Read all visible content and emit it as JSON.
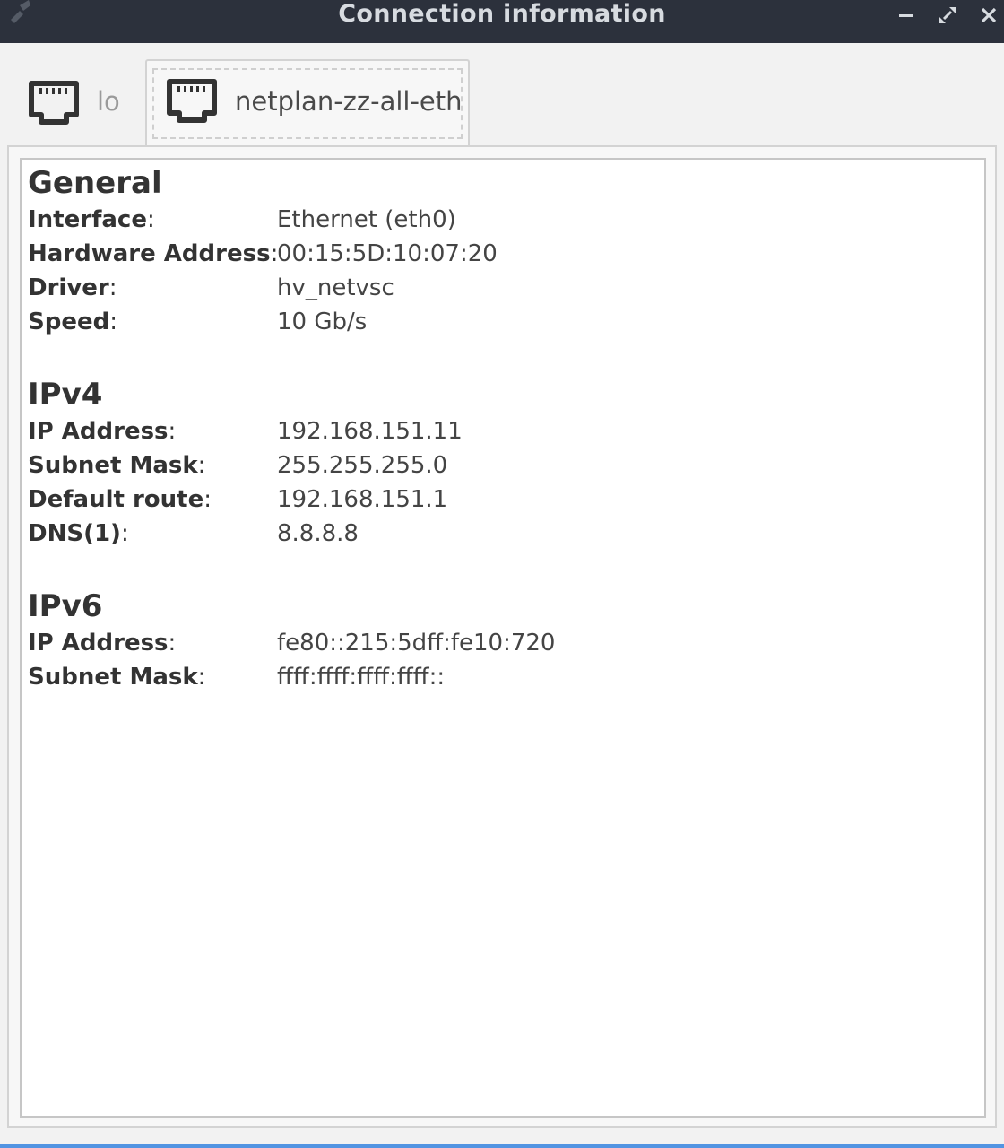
{
  "window": {
    "title": "Connection information"
  },
  "tabs": [
    {
      "label": "lo",
      "icon": "ethernet-port-icon",
      "active": false
    },
    {
      "label": "netplan-zz-all-eth",
      "icon": "ethernet-port-icon",
      "active": true
    }
  ],
  "general": {
    "title": "General",
    "rows": [
      {
        "label": "Interface",
        "value": "Ethernet (eth0)"
      },
      {
        "label": "Hardware Address",
        "value": "00:15:5D:10:07:20"
      },
      {
        "label": "Driver",
        "value": "hv_netvsc"
      },
      {
        "label": "Speed",
        "value": "10 Gb/s"
      }
    ]
  },
  "ipv4": {
    "title": "IPv4",
    "rows": [
      {
        "label": "IP Address",
        "value": "192.168.151.11"
      },
      {
        "label": "Subnet Mask",
        "value": "255.255.255.0"
      },
      {
        "label": "Default route",
        "value": "192.168.151.1"
      },
      {
        "label": "DNS(1)",
        "value": "8.8.8.8"
      }
    ]
  },
  "ipv6": {
    "title": "IPv6",
    "rows": [
      {
        "label": "IP Address",
        "value": "fe80::215:5dff:fe10:720"
      },
      {
        "label": "Subnet Mask",
        "value": "ffff:ffff:ffff:ffff::"
      }
    ]
  },
  "colors": {
    "titlebar": "#2c313c",
    "accent": "#5294e2"
  }
}
